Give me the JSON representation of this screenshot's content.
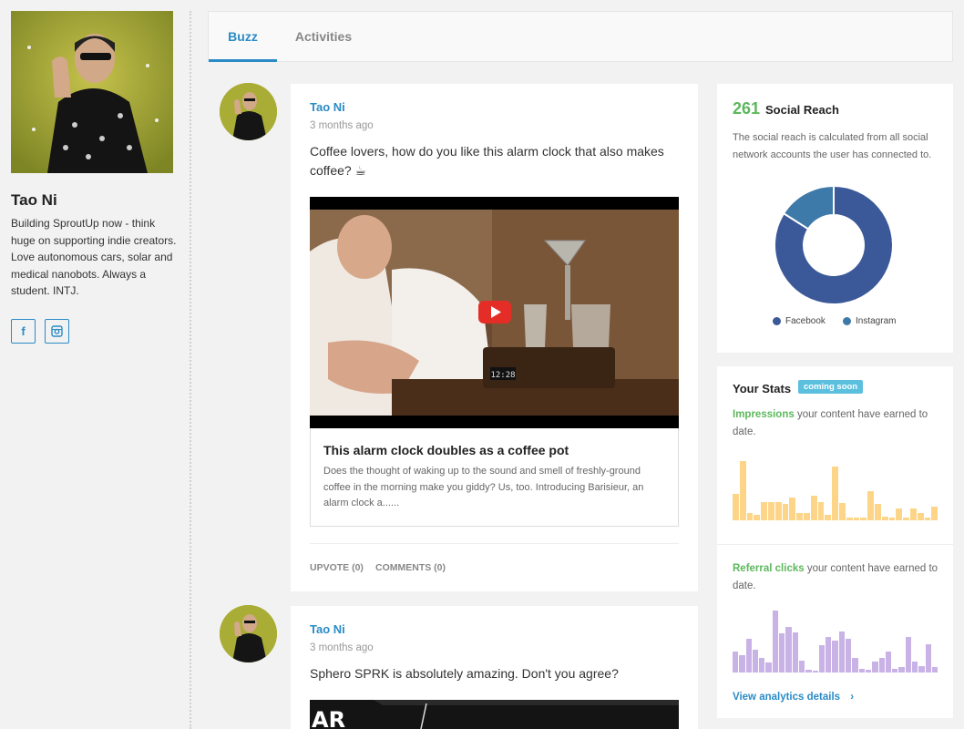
{
  "profile": {
    "name": "Tao Ni",
    "bio": "Building SproutUp now - think huge on supporting indie creators. Love autonomous cars, solar and medical nanobots. Always a student. INTJ.",
    "social": [
      {
        "icon": "facebook-icon",
        "glyph": "f"
      },
      {
        "icon": "instagram-icon",
        "glyph": "◙"
      }
    ]
  },
  "tabs": [
    {
      "label": "Buzz",
      "active": true
    },
    {
      "label": "Activities",
      "active": false
    }
  ],
  "posts": [
    {
      "author": "Tao Ni",
      "time": "3 months ago",
      "text": "Coffee lovers, how do you like this alarm clock that also makes coffee? ☕",
      "clock_display": "12:28",
      "link_title": "This alarm clock doubles as a coffee pot",
      "link_desc": "Does the thought of waking up to the sound and smell of freshly-ground coffee in the morning make you giddy? Us, too. Introducing Barisieur, an alarm clock a......",
      "upvote": "UPVOTE (0)",
      "comments": "COMMENTS (0)"
    },
    {
      "author": "Tao Ni",
      "time": "3 months ago",
      "text": "Sphero SPRK is absolutely amazing. Don't you agree?",
      "video_text": "AR"
    }
  ],
  "social_reach": {
    "value": "261",
    "label": "Social Reach",
    "description": "The social reach is calculated from all social network accounts the user has connected to.",
    "chart_data": {
      "type": "pie",
      "labels": [
        "Facebook",
        "Instagram"
      ],
      "values": [
        84,
        16
      ],
      "colors": [
        "#3b5998",
        "#3e7aa9"
      ]
    }
  },
  "stats": {
    "title": "Your Stats",
    "badge": "coming soon",
    "impressions_label": "Impressions",
    "impressions_text": "your content have earned to date.",
    "impressions_color": "#fcd589",
    "impressions_values": [
      28,
      62,
      8,
      6,
      19,
      19,
      19,
      17,
      24,
      8,
      8,
      26,
      19,
      6,
      56,
      18,
      3,
      3,
      3,
      31,
      17,
      4,
      3,
      12,
      3,
      12,
      8,
      3,
      14
    ],
    "referral_label": "Referral clicks",
    "referral_text": "your content have earned to date.",
    "referral_color": "#c9b3e6",
    "referral_values": [
      24,
      20,
      38,
      26,
      16,
      11,
      70,
      44,
      52,
      45,
      13,
      3,
      2,
      31,
      40,
      36,
      46,
      38,
      16,
      4,
      3,
      12,
      16,
      24,
      4,
      6,
      40,
      12,
      7,
      32,
      6
    ],
    "analytics_link": "View analytics details",
    "analytics_chevron": "›"
  }
}
